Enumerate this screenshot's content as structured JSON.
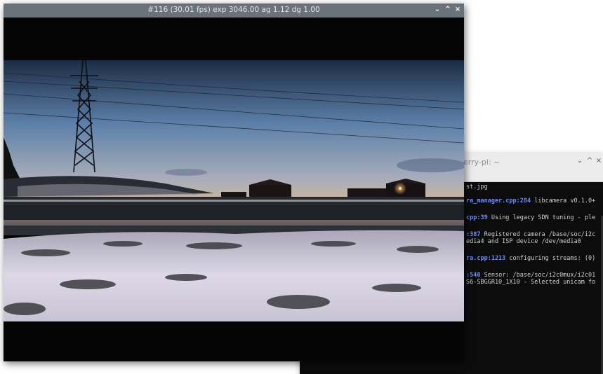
{
  "terminal": {
    "title": "erry-pi: ~",
    "controls": {
      "minimize": "⌄",
      "maximize": "^",
      "close": "×"
    },
    "lines": [
      {
        "hl": "",
        "text": "st.jpg"
      },
      {
        "hl": "ra_manager.cpp:284",
        "text": " libcamera v0.1.0+"
      },
      {
        "hl": "cpp:39",
        "text": " Using legacy SDN tuning - ple"
      },
      {
        "hl": ":387",
        "text": " Registered camera /base/soc/i2c"
      },
      {
        "hl": "",
        "text": "edia4 and ISP device /dev/media0"
      },
      {
        "hl": "ra.cpp:1213",
        "text": " configuring streams: (0)"
      },
      {
        "hl": ":540",
        "text": " Sensor: /base/soc/i2c0mux/i2c01"
      },
      {
        "hl": "",
        "text": "S6-SBGGR10_1X10 - Selected unicam fo"
      }
    ]
  },
  "camera_window": {
    "title": "#116 (30.01 fps) exp 3046.00 ag 1.12 dg 1.00",
    "controls": {
      "minimize": "⌄",
      "maximize": "^",
      "close": "×"
    }
  },
  "colors": {
    "sky_top": "#1c2c44",
    "sky_mid": "#5c7fa8",
    "sky_horizon": "#c9b59c",
    "snow": "#dcd8e6",
    "field_dark": "#1e2228"
  }
}
